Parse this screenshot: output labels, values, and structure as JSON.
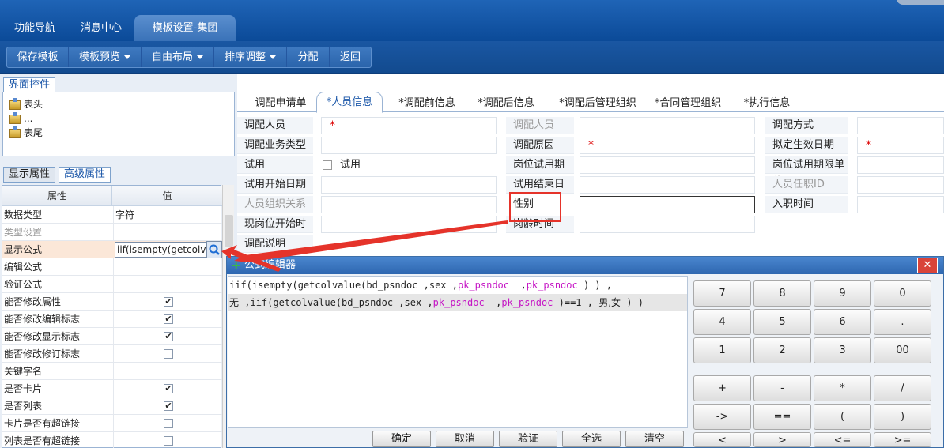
{
  "nav": {
    "tabs": [
      "功能导航",
      "消息中心",
      "模板设置-集团"
    ]
  },
  "toolbar": {
    "save": "保存模板",
    "preview": "模板预览",
    "layout": "自由布局",
    "sort": "排序调整",
    "assign": "分配",
    "back": "返回"
  },
  "left_top": {
    "tab": "界面控件",
    "tree": [
      "表头",
      "...",
      "表尾"
    ]
  },
  "props": {
    "tabs": [
      "显示属性",
      "高级属性"
    ],
    "col_key": "属性",
    "col_value": "值",
    "rows": [
      {
        "k": "数据类型",
        "v": "字符"
      },
      {
        "k": "类型设置",
        "v": ""
      },
      {
        "k": "显示公式",
        "v": "iif(isempty(getcolvalue"
      },
      {
        "k": "编辑公式",
        "v": ""
      },
      {
        "k": "验证公式",
        "v": ""
      },
      {
        "k": "能否修改属性",
        "v": "✔"
      },
      {
        "k": "能否修改编辑标志",
        "v": "✔"
      },
      {
        "k": "能否修改显示标志",
        "v": "✔"
      },
      {
        "k": "能否修改修订标志",
        "v": ""
      },
      {
        "k": "关键字名",
        "v": ""
      },
      {
        "k": "是否卡片",
        "v": "✔"
      },
      {
        "k": "是否列表",
        "v": "✔"
      },
      {
        "k": "卡片是否有超链接",
        "v": ""
      },
      {
        "k": "列表是否有超链接",
        "v": ""
      }
    ]
  },
  "right": {
    "tabs": [
      "调配申请单",
      "*人员信息",
      "*调配前信息",
      "*调配后信息",
      "*调配后管理组织",
      "*合同管理组织",
      "*执行信息"
    ],
    "fields": {
      "c1": [
        "调配人员",
        "调配业务类型",
        "试用",
        "试用开始日期",
        "人员组织关系",
        "现岗位开始时间",
        "调配说明"
      ],
      "c2": [
        "调配人员",
        "调配原因",
        "岗位试用期限",
        "试用结束日期",
        "性别",
        "岗龄时间"
      ],
      "c3": [
        "调配方式",
        "拟定生效日期",
        "岗位试用期限单位",
        "人员任职ID",
        "入职时间"
      ],
      "check_label": "试用",
      "required": "*"
    }
  },
  "dialog": {
    "title": "公式编辑器",
    "close": "✕",
    "line1_a": "iif(isempty(getcolvalue(bd_psndoc ,sex ,",
    "line1_pk1": "pk_psndoc",
    "line1_mid": "  ,",
    "line1_pk2": "pk_psndoc",
    "line1_end": " ) ) ,",
    "line2_cn1": "无",
    "line2_a": " ,iif(getcolvalue(bd_psndoc ,sex ,",
    "line2_pk1": "pk_psndoc",
    "line2_mid": "  ,",
    "line2_pk2": "pk_psndoc",
    "line2_b": " )==1 , ",
    "line2_cn2": "男,女",
    "line2_end": " ) )",
    "buttons": [
      "确定",
      "取消",
      "验证",
      "全选",
      "清空"
    ],
    "keys": [
      "7",
      "8",
      "9",
      "0",
      "4",
      "5",
      "6",
      ".",
      "1",
      "2",
      "3",
      "00",
      "+",
      "-",
      "*",
      "/",
      "->",
      "==",
      "(",
      ")",
      "<",
      ">",
      "<=",
      ">="
    ]
  }
}
